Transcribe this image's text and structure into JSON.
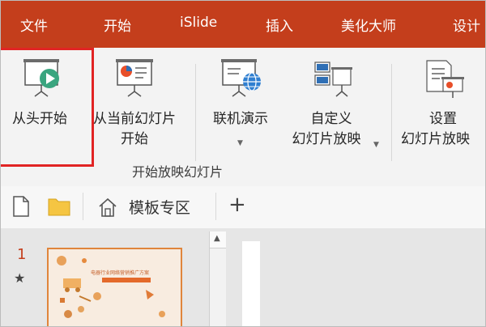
{
  "tabs": [
    "文件",
    "开始",
    "iSlide",
    "插入",
    "美化大师",
    "设计"
  ],
  "ribbon": {
    "from_start": "从头开始",
    "from_current_line1": "从当前幻灯片",
    "from_current_line2": "开始",
    "online_present": "联机演示",
    "custom_line1": "自定义",
    "custom_line2": "幻灯片放映",
    "setup_line1": "设置",
    "setup_line2": "幻灯片放映",
    "group_label": "开始放映幻灯片"
  },
  "toolbar": {
    "template_zone": "模板专区",
    "add": "+"
  },
  "slides_panel": {
    "slide_number": "1",
    "star": "★",
    "thumbnail_title": "电器行业网络营销推广方案",
    "scroll_up": "▲"
  },
  "colors": {
    "accent": "#c43e1c",
    "highlight": "#e12424"
  }
}
